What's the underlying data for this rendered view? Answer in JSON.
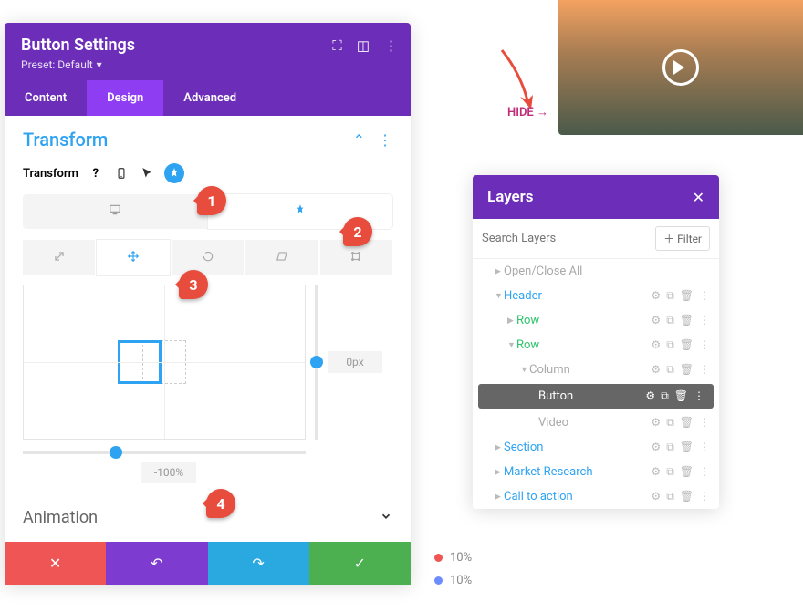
{
  "settings": {
    "title": "Button Settings",
    "preset_label": "Preset: Default",
    "tabs": {
      "content": "Content",
      "design": "Design",
      "advanced": "Advanced"
    },
    "transform": {
      "section_title": "Transform",
      "field_label": "Transform",
      "value_y": "0px",
      "value_x": "-100%"
    },
    "animation": {
      "title": "Animation"
    }
  },
  "callouts": {
    "c1": "1",
    "c2": "2",
    "c3": "3",
    "c4": "4"
  },
  "hide_link": "HIDE",
  "layers": {
    "title": "Layers",
    "search_placeholder": "Search Layers",
    "filter_label": "Filter",
    "open_close": "Open/Close All",
    "items": {
      "header": "Header",
      "row1": "Row",
      "row2": "Row",
      "column": "Column",
      "button": "Button",
      "video": "Video",
      "section": "Section",
      "market": "Market Research",
      "cta": "Call to action"
    }
  },
  "legend": {
    "a": "10%",
    "b": "10%"
  },
  "icons": {
    "expand": "expand-icon",
    "layout": "layout-icon",
    "more": "more-vert-icon",
    "chevron_down": "chevron-down-icon",
    "chevron_up": "chevron-up-icon",
    "help": "help-icon",
    "mobile": "mobile-icon",
    "cursor": "cursor-icon",
    "pin": "pin-icon",
    "desktop": "desktop-icon",
    "arrows": "resize-icon",
    "move": "move-icon",
    "skew": "skew-icon",
    "bounds": "bounds-icon",
    "close": "close-icon",
    "undo": "undo-icon",
    "redo": "redo-icon",
    "check": "check-icon",
    "gear": "gear-icon",
    "dup": "duplicate-icon",
    "trash": "trash-icon",
    "plus": "plus-icon",
    "x": "x-icon"
  }
}
